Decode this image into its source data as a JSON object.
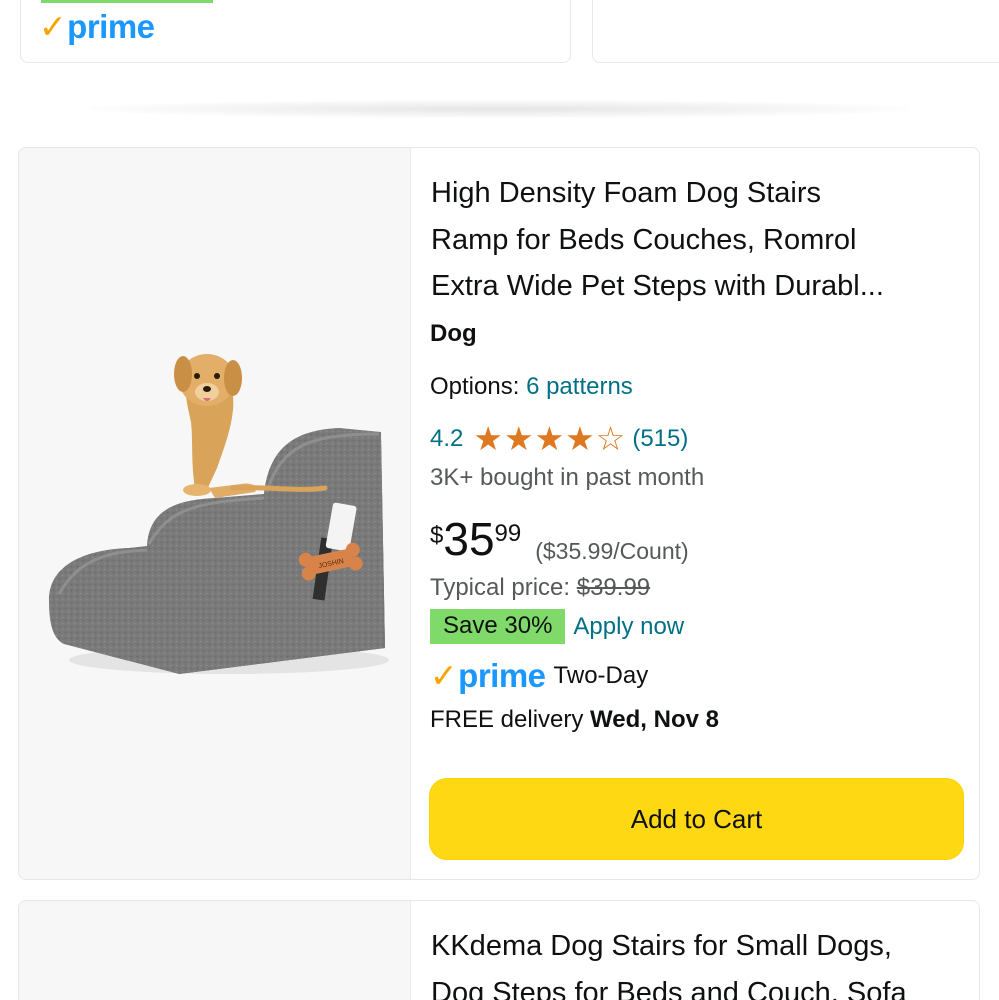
{
  "top_card": {
    "prime_label": "prime"
  },
  "product": {
    "title_lines": [
      "High Density Foam Dog Stairs",
      "Ramp for Beds Couches, Romrol",
      "Extra Wide Pet Steps with Durabl..."
    ],
    "brand": "Dog",
    "options_label": "Options:",
    "options_link": "6 patterns",
    "rating": "4.2",
    "rating_stars": 4.2,
    "review_count": "(515)",
    "bought": "3K+ bought in past month",
    "price_symbol": "$",
    "price_whole": "35",
    "price_fraction": "99",
    "unit_price": "($35.99/Count)",
    "typical_label": "Typical price:",
    "typical_price": "$39.99",
    "save_badge": "Save 30%",
    "apply_link": "Apply now",
    "prime_label": "prime",
    "prime_speed": "Two-Day",
    "delivery_prefix": "FREE delivery",
    "delivery_date": "Wed, Nov 8",
    "add_to_cart": "Add to Cart",
    "bone_tag": "JOSHIN"
  },
  "next_product": {
    "title_lines": [
      "KKdema Dog Stairs for Small Dogs,",
      "Dog Steps for Beds and Couch, Sofa"
    ]
  },
  "colors": {
    "prime_blue": "#1a98ff",
    "prime_check": "#f7a300",
    "link": "#007185",
    "star": "#de7921",
    "save_badge": "#7fda69",
    "cart_button": "#ffd814"
  }
}
